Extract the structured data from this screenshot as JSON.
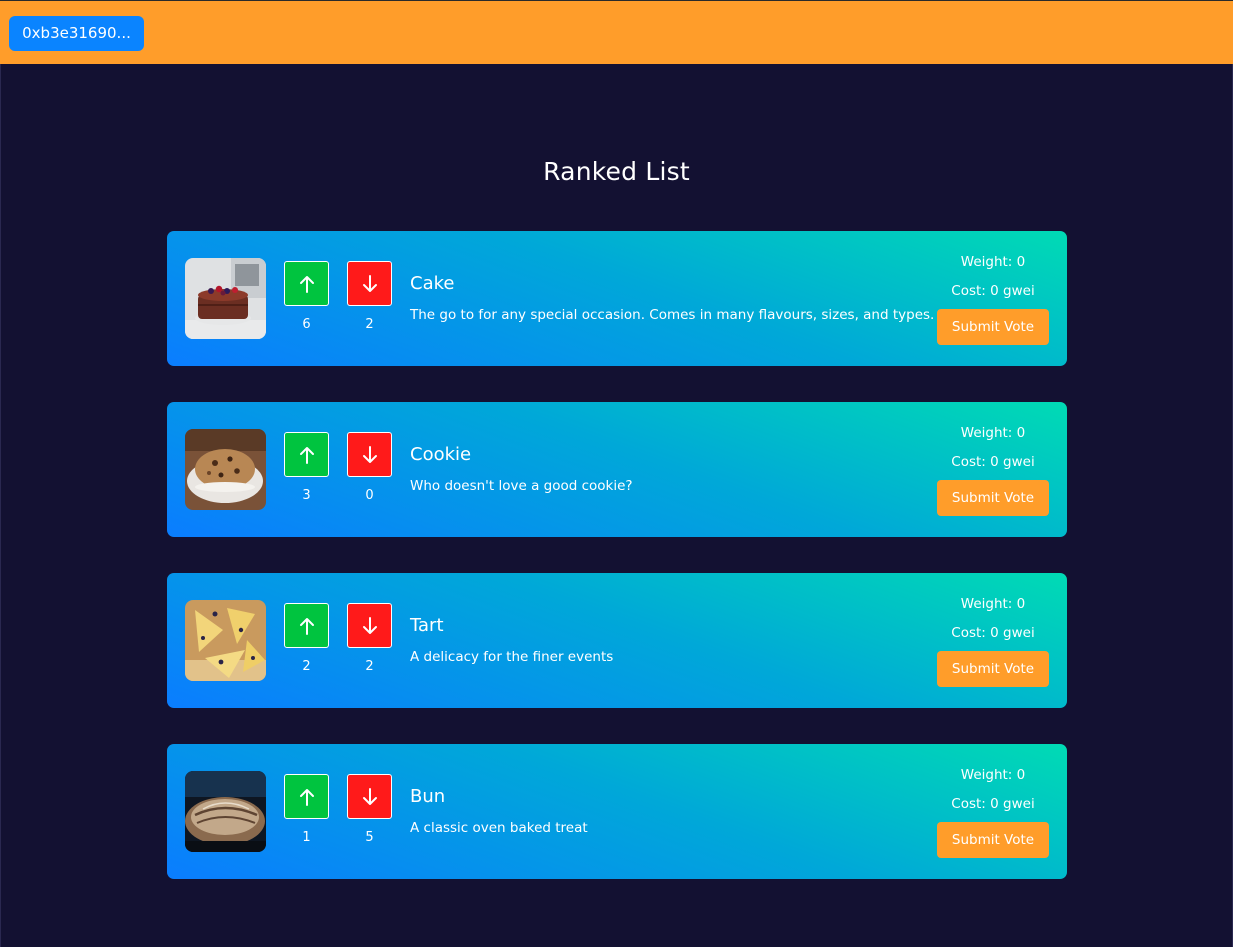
{
  "header": {
    "wallet_label": "0xb3e31690..."
  },
  "page": {
    "title": "Ranked List"
  },
  "colors": {
    "topbar": "#ff9d2a",
    "background": "#131132",
    "up": "#00c43f",
    "down": "#ff1a1a",
    "wallet": "#0a84ff"
  },
  "items": [
    {
      "name": "Cake",
      "description": "The go to for any special occasion. Comes in many flavours, sizes, and types.",
      "upvotes": "6",
      "downvotes": "2",
      "weight": "Weight: 0",
      "cost": "Cost: 0 gwei",
      "submit_label": "Submit Vote",
      "image": "cake-photo"
    },
    {
      "name": "Cookie",
      "description": "Who doesn't love a good cookie?",
      "upvotes": "3",
      "downvotes": "0",
      "weight": "Weight: 0",
      "cost": "Cost: 0 gwei",
      "submit_label": "Submit Vote",
      "image": "cookie-photo"
    },
    {
      "name": "Tart",
      "description": "A delicacy for the finer events",
      "upvotes": "2",
      "downvotes": "2",
      "weight": "Weight: 0",
      "cost": "Cost: 0 gwei",
      "submit_label": "Submit Vote",
      "image": "tart-photo"
    },
    {
      "name": "Bun",
      "description": "A classic oven baked treat",
      "upvotes": "1",
      "downvotes": "5",
      "weight": "Weight: 0",
      "cost": "Cost: 0 gwei",
      "submit_label": "Submit Vote",
      "image": "bun-photo"
    }
  ]
}
